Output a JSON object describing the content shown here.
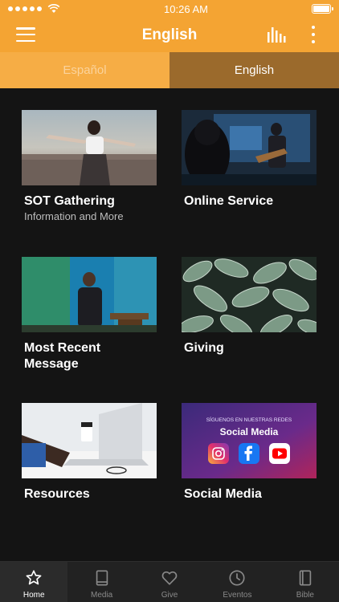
{
  "status": {
    "time": "10:26 AM"
  },
  "header": {
    "title": "English"
  },
  "language_tabs": [
    {
      "label": "Español",
      "selected": false
    },
    {
      "label": "English",
      "selected": true
    }
  ],
  "cards": [
    {
      "title": "SOT Gathering",
      "subtitle": "Information and More"
    },
    {
      "title": "Online Service"
    },
    {
      "title": "Most Recent Message"
    },
    {
      "title": "Giving"
    },
    {
      "title": "Resources"
    },
    {
      "title": "Social Media"
    }
  ],
  "social_banner": {
    "caption": "SÍGUENOS EN NUESTRAS REDES",
    "heading": "Social Media"
  },
  "tab_bar": [
    {
      "label": "Home",
      "icon": "star-icon",
      "active": true
    },
    {
      "label": "Media",
      "icon": "book-icon",
      "active": false
    },
    {
      "label": "Give",
      "icon": "heart-icon",
      "active": false
    },
    {
      "label": "Eventos",
      "icon": "clock-icon",
      "active": false
    },
    {
      "label": "Bible",
      "icon": "bible-icon",
      "active": false
    }
  ],
  "colors": {
    "accent": "#f4a433",
    "selected_tab": "#9b6a2c",
    "background": "#141414"
  }
}
